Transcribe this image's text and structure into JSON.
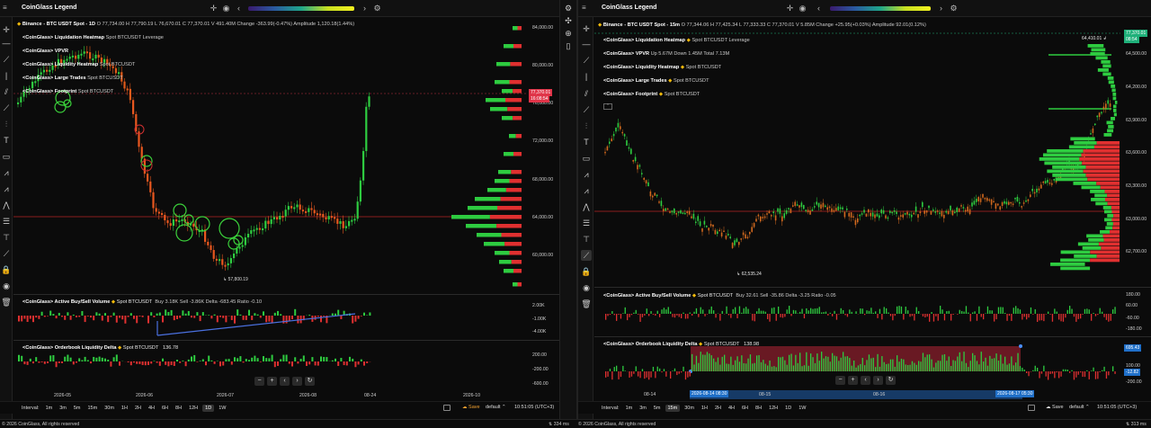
{
  "app": {
    "legend_title": "CoinGlass Legend",
    "copyright": "© 2026 CoinGlass, All rights reserved"
  },
  "left": {
    "symbol": "Binance - BTC USDT Spot - 1D",
    "ohlc": "O 77,734.00  H 77,790.19  L 76,670.01  C 77,370.01  V 491.40M  Change -363.99(-0.47%)  Amplitude 1,120.18(1.44%)",
    "indicators": [
      "<CoinGlass> Liquidation Heatmap",
      "<CoinGlass> VPVR",
      "<CoinGlass> Liquidity Heatmap",
      "<CoinGlass> Large Trades",
      "<CoinGlass> Footprint"
    ],
    "indicator_tags": [
      "Spot BTCUSDT  Leverage",
      "",
      "Spot BTCUSDT",
      "Spot BTCUSDT",
      "Spot BTCUSDT"
    ],
    "yaxis": [
      "84,000.00",
      "80,000.00",
      "76,000.00",
      "72,000.00",
      "68,000.00",
      "64,000.00",
      "60,000.00"
    ],
    "price_tag": "77,370.01",
    "price_tag2": "16:08:54",
    "low_label": "57,800.19",
    "buysell": "<CoinGlass> Active Buy/Sell Volume",
    "buysell_tag": "Spot BTCUSDT",
    "buysell_vals": "Buy 3.18K  Sell -3.86K  Delta -683.45  Ratio -0.10",
    "buysell_axis": [
      "2.00K",
      "-1.00K",
      "-4.00K"
    ],
    "ob": "<CoinGlass> Orderbook Liquidity Delta",
    "ob_tag": "Spot BTCUSDT",
    "ob_val": "136.78",
    "ob_axis": [
      "200.00",
      "-200.00",
      "-600.00"
    ],
    "xaxis": [
      "2026-05",
      "2026-06",
      "2026-07",
      "2026-08",
      "08-24",
      "2026-10"
    ],
    "interval_label": "Interval:",
    "intervals": [
      "1m",
      "3m",
      "5m",
      "15m",
      "30m",
      "1H",
      "2H",
      "4H",
      "6H",
      "8H",
      "12H",
      "1D",
      "1W"
    ],
    "active_interval": "1D",
    "time": "10:51:05 (UTC+3)",
    "ms": "334 ms"
  },
  "right": {
    "symbol": "Binance - BTC USDT Spot - 15m",
    "ohlc": "O 77,344.06  H 77,425.34  L 77,333.33  C 77,370.01  V 5.85M  Change +25.95(+0.03%)  Amplitude 92.01(0.12%)",
    "indicators": [
      "<CoinGlass> Liquidation Heatmap",
      "<CoinGlass> VPVR",
      "<CoinGlass> Liquidity Heatmap",
      "<CoinGlass> Large Trades",
      "<CoinGlass> Footprint"
    ],
    "indicator_tags": [
      "Spot BTCUSDT  Leverage",
      "Up 5.67M  Down 1.45M  Total 7.13M",
      "Spot BTCUSDT",
      "Spot BTCUSDT",
      "Spot BTCUSDT"
    ],
    "yaxis": [
      "64,500.00",
      "64,200.00",
      "63,900.00",
      "63,600.00",
      "63,300.00",
      "63,000.00",
      "62,700.00"
    ],
    "price_tag": "77,370.01",
    "price_tag2": "08:54",
    "high_label": "64,410.01",
    "low_label": "62,535.24",
    "buysell": "<CoinGlass> Active Buy/Sell Volume",
    "buysell_tag": "Spot BTCUSDT",
    "buysell_vals": "Buy 32.61  Sell -35.86  Delta -3.25  Ratio -0.05",
    "buysell_axis": [
      "180.00",
      "60.00",
      "-60.00",
      "-180.00"
    ],
    "ob": "<CoinGlass> Orderbook Liquidity Delta",
    "ob_tag": "Spot BTCUSDT",
    "ob_val": "138.98",
    "ob_axis": [
      "695.43",
      "100.00",
      "-12.82",
      "-200.00"
    ],
    "xaxis": [
      "08-14",
      "08-15",
      "08-16"
    ],
    "range_start": "2026-08-14 08:30",
    "range_end": "2026-08-17 05:30",
    "interval_label": "Interval:",
    "intervals": [
      "1m",
      "3m",
      "5m",
      "15m",
      "30m",
      "1H",
      "2H",
      "4H",
      "6H",
      "8H",
      "12H",
      "1D",
      "1W"
    ],
    "active_interval": "15m",
    "time": "10:51:05 (UTC+3)",
    "ms": "313 ms",
    "save": "Save",
    "default": "default"
  }
}
